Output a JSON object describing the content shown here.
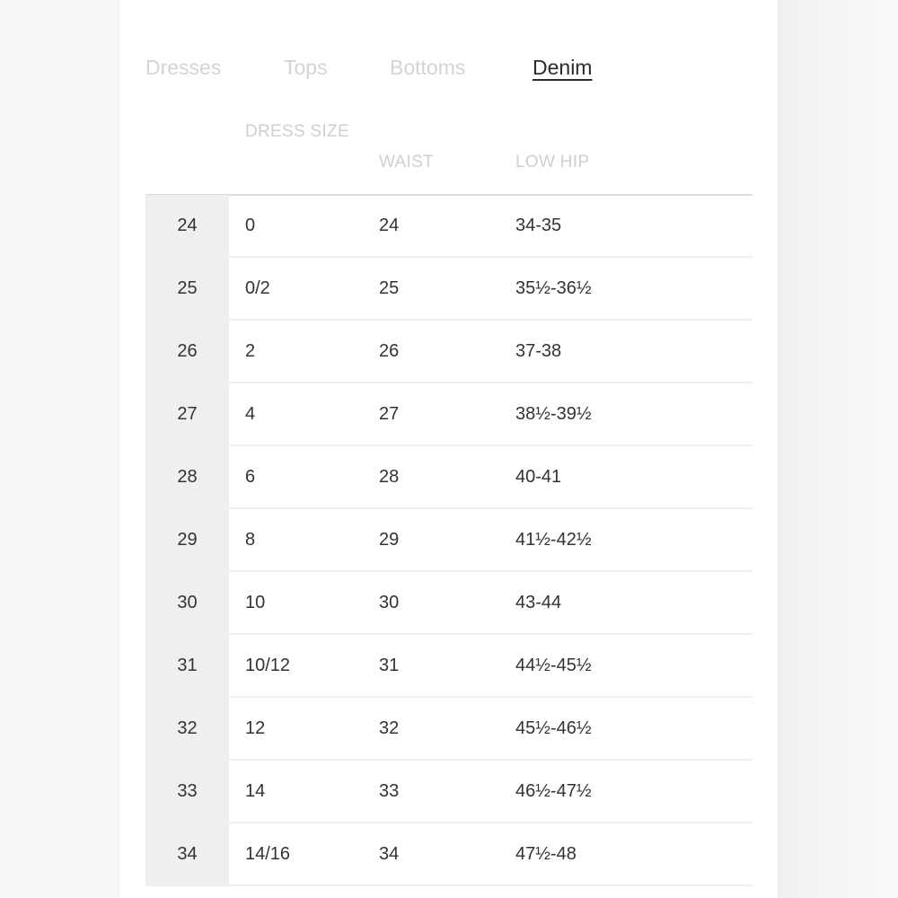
{
  "tabs": [
    {
      "label": "Dresses",
      "active": false
    },
    {
      "label": "Tops",
      "active": false
    },
    {
      "label": "Bottoms",
      "active": false
    },
    {
      "label": "Denim",
      "active": true
    }
  ],
  "table": {
    "headers": [
      "DRESS SIZE",
      "WAIST",
      "LOW HIP"
    ],
    "rows": [
      {
        "size": "24",
        "dress_size": "0",
        "waist": "24",
        "low_hip": "34-35"
      },
      {
        "size": "25",
        "dress_size": "0/2",
        "waist": "25",
        "low_hip": "35½-36½"
      },
      {
        "size": "26",
        "dress_size": "2",
        "waist": "26",
        "low_hip": "37-38"
      },
      {
        "size": "27",
        "dress_size": "4",
        "waist": "27",
        "low_hip": "38½-39½"
      },
      {
        "size": "28",
        "dress_size": "6",
        "waist": "28",
        "low_hip": "40-41"
      },
      {
        "size": "29",
        "dress_size": "8",
        "waist": "29",
        "low_hip": "41½-42½"
      },
      {
        "size": "30",
        "dress_size": "10",
        "waist": "30",
        "low_hip": "43-44"
      },
      {
        "size": "31",
        "dress_size": "10/12",
        "waist": "31",
        "low_hip": "44½-45½"
      },
      {
        "size": "32",
        "dress_size": "12",
        "waist": "32",
        "low_hip": "45½-46½"
      },
      {
        "size": "33",
        "dress_size": "14",
        "waist": "33",
        "low_hip": "46½-47½"
      },
      {
        "size": "34",
        "dress_size": "14/16",
        "waist": "34",
        "low_hip": "47½-48"
      }
    ]
  }
}
